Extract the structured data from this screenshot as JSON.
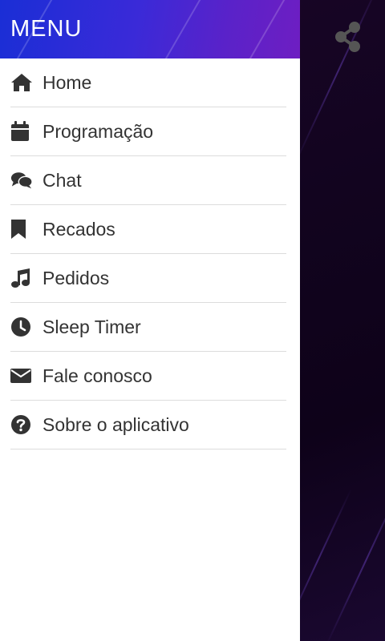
{
  "drawer": {
    "title": "MENU",
    "items": [
      {
        "label": "Home",
        "icon": "home-icon"
      },
      {
        "label": "Programação",
        "icon": "calendar-icon"
      },
      {
        "label": "Chat",
        "icon": "chat-icon"
      },
      {
        "label": "Recados",
        "icon": "bookmark-icon"
      },
      {
        "label": "Pedidos",
        "icon": "music-icon"
      },
      {
        "label": "Sleep Timer",
        "icon": "clock-icon"
      },
      {
        "label": "Fale conosco",
        "icon": "envelope-icon"
      },
      {
        "label": "Sobre o aplicativo",
        "icon": "question-circle-icon"
      }
    ]
  },
  "toolbar": {
    "share_icon": "share-icon"
  },
  "colors": {
    "header_gradient_start": "#1a2ed6",
    "header_gradient_end": "#6e1ec2",
    "background": "#12041f",
    "icon": "#333333",
    "text": "#333333",
    "divider": "#dcdcdc"
  }
}
